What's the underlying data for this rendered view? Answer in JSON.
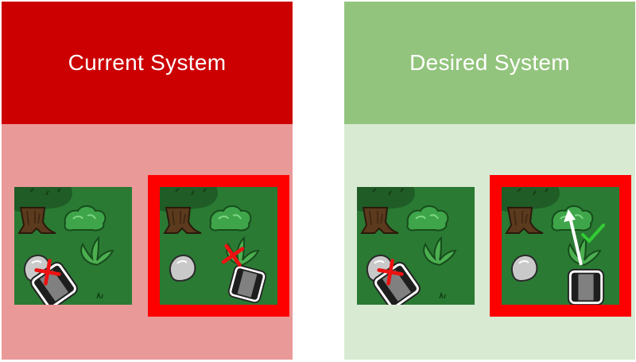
{
  "panels": {
    "current": {
      "title": "Current System",
      "header_color": "#cc0000",
      "body_color": "#ea9999",
      "scenes": [
        {
          "robot": "facing-rock-blocked",
          "mark": "red-x-icon",
          "highlighted": false
        },
        {
          "robot": "facing-plant-blocked",
          "mark": "red-x-icon",
          "highlighted": true
        }
      ]
    },
    "desired": {
      "title": "Desired System",
      "header_color": "#93c47d",
      "body_color": "#d9ead3",
      "scenes": [
        {
          "robot": "facing-rock-blocked",
          "mark": "red-x-icon",
          "highlighted": false
        },
        {
          "robot": "moves-through-plant",
          "mark": "green-check-icon",
          "highlighted": true
        }
      ]
    }
  },
  "colors": {
    "grass": "#2a7a33",
    "highlight_frame": "#ff0000",
    "blocked_mark": "#ee1111",
    "ok_mark": "#33cc33"
  }
}
